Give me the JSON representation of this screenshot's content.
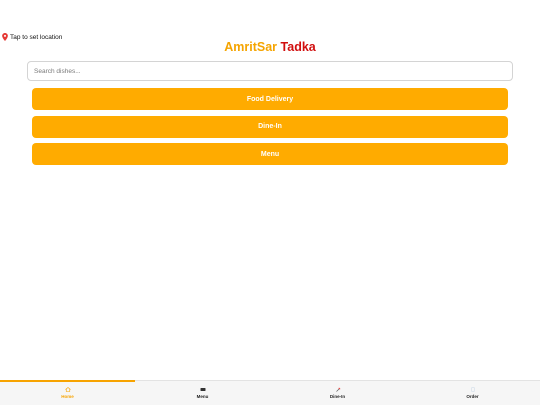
{
  "header": {
    "location_text": "Tap to set location",
    "brand_part1": "AmritSar",
    "brand_part2": "Tadka"
  },
  "search": {
    "placeholder": "Search dishes...",
    "value": ""
  },
  "actions": [
    {
      "label": "Food Delivery"
    },
    {
      "label": "Dine-In"
    },
    {
      "label": "Menu"
    }
  ],
  "tabbar": {
    "active": "Home",
    "tabs": [
      {
        "label": "Home",
        "icon": "home-icon"
      },
      {
        "label": "Menu",
        "icon": "menu-icon"
      },
      {
        "label": "Dine-In",
        "icon": "dine-in-icon"
      },
      {
        "label": "Order",
        "icon": "order-icon"
      }
    ]
  },
  "colors": {
    "primary": "#ffab00",
    "brand_orange": "#f5a400",
    "brand_red": "#d10f0f",
    "active_tab": "#f7a300"
  }
}
